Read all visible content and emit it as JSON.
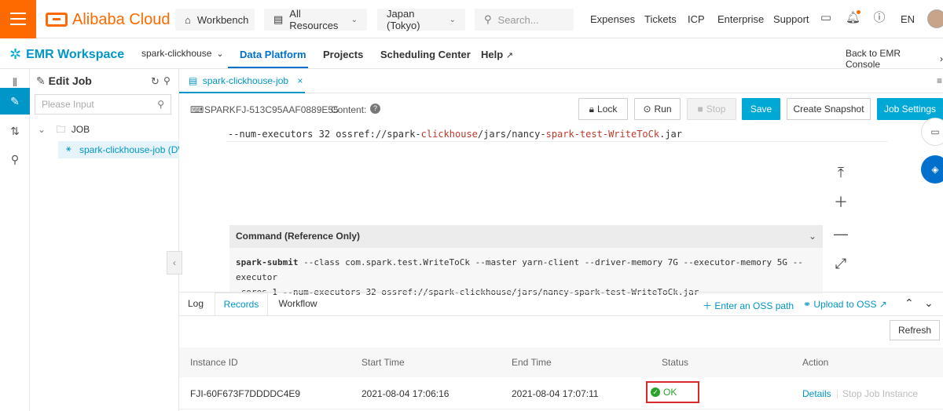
{
  "topbar": {
    "brand": "Alibaba Cloud",
    "workbench": "Workbench",
    "resources": "All Resources",
    "region": "Japan (Tokyo)",
    "search_placeholder": "Search...",
    "links": [
      "Expenses",
      "Tickets",
      "ICP",
      "Enterprise",
      "Support"
    ],
    "language": "EN"
  },
  "secondbar": {
    "workspace": "EMR Workspace",
    "cluster": "spark-clickhouse",
    "tabs": [
      "Data Platform",
      "Projects",
      "Scheduling Center",
      "Help"
    ],
    "back": "Back to EMR Console"
  },
  "tree": {
    "title": "Edit Job",
    "search_placeholder": "Please Input",
    "folder": "JOB",
    "job": "spark-clickhouse-job (DW"
  },
  "jobtab": {
    "label": "spark-clickhouse-job"
  },
  "toolbar": {
    "type": "SPARK",
    "job_id": "FJ-513C95AAF0889E55",
    "content_label": "Content:",
    "lock": "Lock",
    "run": "Run",
    "stop": "Stop",
    "save": "Save",
    "snapshot": "Create Snapshot",
    "settings": "Job Settings"
  },
  "editor": {
    "code_prefix": "--num-executors 32 ossref://spark-",
    "code_kw1": "clickhouse",
    "code_mid": "/jars/nancy-",
    "code_kw2": "spark-test-WriteToCk",
    "code_suffix": ".jar",
    "command_title": "Command (Reference Only)",
    "command_cmd": "spark-submit",
    "command_line1": " --class com.spark.test.WriteToCk --master yarn-client --driver-memory 7G --executor-memory 5G --executor",
    "command_line2": "-cores 1 --num-executors 32 ossref://spark-clickhouse/jars/nancy-spark-test-WriteToCk.jar"
  },
  "bottom": {
    "tabs": [
      "Log",
      "Records",
      "Workflow"
    ],
    "active_tab": "Records",
    "enter_oss": "Enter an OSS path",
    "upload_oss": "Upload to OSS",
    "refresh": "Refresh",
    "columns": [
      "Instance ID",
      "Start Time",
      "End Time",
      "Status",
      "Action"
    ],
    "row": {
      "instance_id": "FJI-60F673F7DDDDC4E9",
      "start": "2021-08-04 17:06:16",
      "end": "2021-08-04 17:07:11",
      "status": "OK",
      "details": "Details",
      "stop_instance": "Stop Job Instance"
    }
  },
  "colors": {
    "accent": "#0096c7",
    "brand": "#ff6a00",
    "ok": "#29a329",
    "highlight": "#d9272e"
  }
}
